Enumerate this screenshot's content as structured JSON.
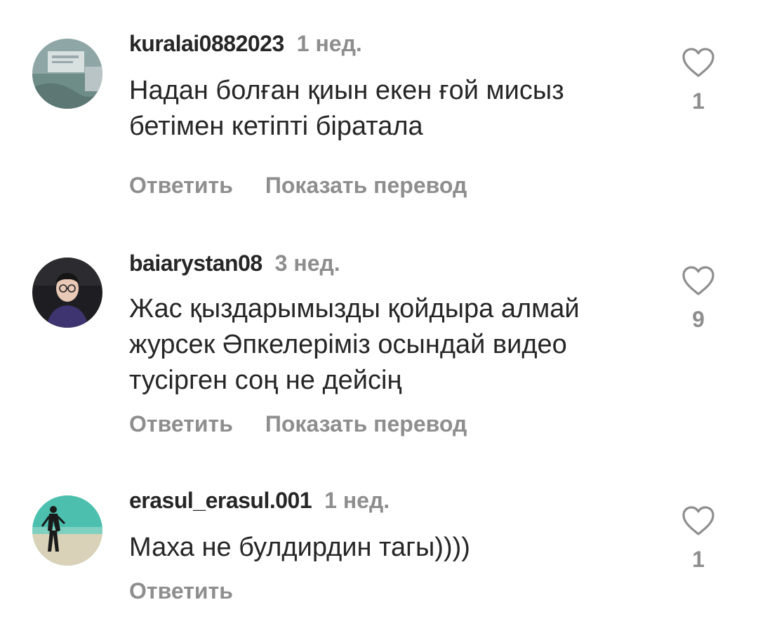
{
  "comments": [
    {
      "username": "kuralai0882023",
      "time": "1 нед.",
      "text": "Надан болған қиын екен ғой мисыз бетімен кетіпті біратала",
      "reply_label": "Ответить",
      "translate_label": "Показать перевод",
      "likes": "1"
    },
    {
      "username": "baiarystan08",
      "time": "3 нед.",
      "text": "Жас қыздарымызды қойдыра алмай журсек Әпкелеріміз осындай видео тусірген соң не дейсің",
      "reply_label": "Ответить",
      "translate_label": "Показать перевод",
      "likes": "9"
    },
    {
      "username": "erasul_erasul.001",
      "time": "1 нед.",
      "text": "Маха не булдирдин тагы))))",
      "reply_label": "Ответить",
      "likes": "1"
    }
  ],
  "icons": {
    "like": "heart-outline-icon"
  },
  "colors": {
    "primary_text": "#262626",
    "secondary_text": "#8e8e8e",
    "background": "#ffffff"
  }
}
